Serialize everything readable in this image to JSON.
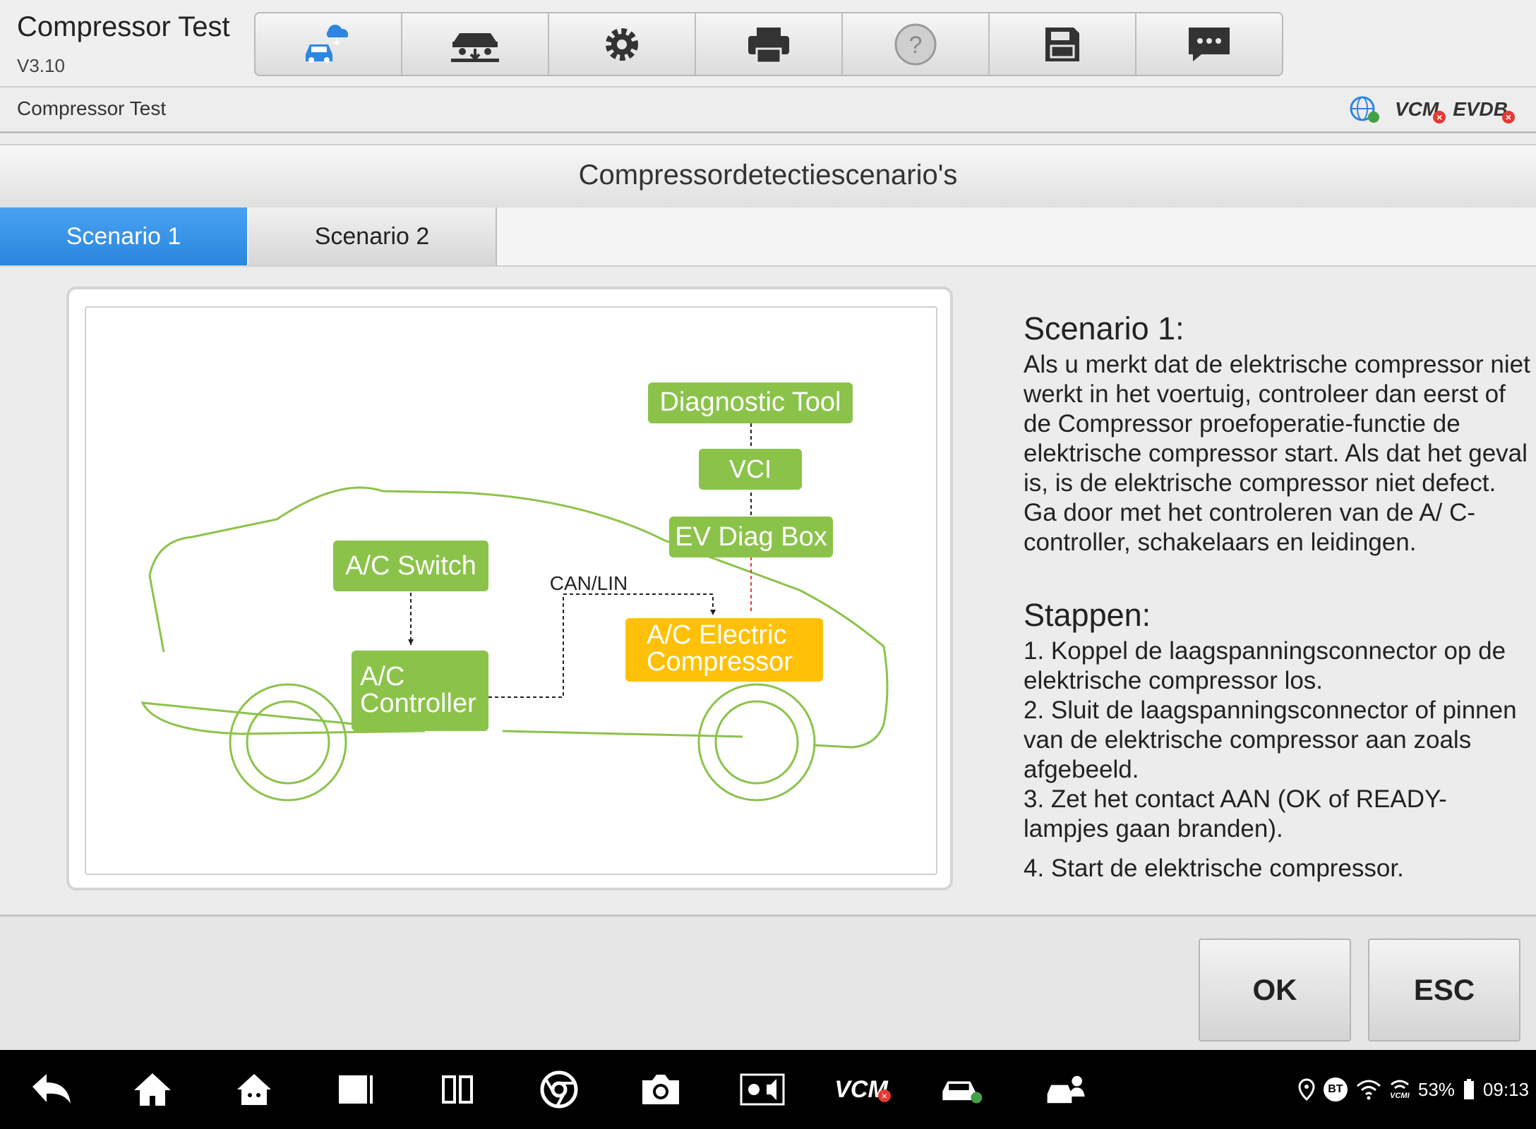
{
  "app": {
    "title": "Compressor Test",
    "version": "V3.10"
  },
  "breadcrumb": "Compressor Test",
  "status": {
    "vcm": "VCM",
    "evdb": "EVDB"
  },
  "section_title": "Compressordetectiescenario's",
  "tabs": [
    {
      "label": "Scenario 1"
    },
    {
      "label": "Scenario 2"
    }
  ],
  "diagram": {
    "diagnostic_tool": "Diagnostic Tool",
    "vci": "VCI",
    "ev_diag_box": "EV Diag Box",
    "ac_switch": "A/C Switch",
    "can_lin": "CAN/LIN",
    "ac_controller_1": "A/C",
    "ac_controller_2": "Controller",
    "ac_compressor_1": "A/C Electric",
    "ac_compressor_2": "Compressor"
  },
  "description": {
    "heading": "Scenario 1:",
    "body": "Als u merkt dat de elektrische compressor niet werkt in het voertuig, controleer dan eerst of de Compressor proefoperatie-functie de elektrische compressor start. Als dat het geval is, is de elektrische compressor niet defect. Ga door met het controleren van de A/ C-controller, schakelaars en leidingen.",
    "steps_heading": "Stappen:",
    "steps": [
      "1. Koppel de laagspanningsconnector op de elektrische compressor los.",
      "2. Sluit de laagspanningsconnector of pinnen van de elektrische compressor aan zoals afgebeeld.",
      "3. Zet het contact AAN (OK of READY-lampjes gaan branden).",
      "4. Start de elektrische compressor."
    ]
  },
  "buttons": {
    "ok": "OK",
    "esc": "ESC"
  },
  "system": {
    "vcm": "VCM",
    "battery": "53%",
    "time": "09:13",
    "bt": "BT",
    "vcmi": "VCMI"
  },
  "icons": [
    "car-cloud-icon",
    "car-lift-icon",
    "gear-icon",
    "printer-icon",
    "help-icon",
    "save-icon",
    "chat-icon"
  ]
}
